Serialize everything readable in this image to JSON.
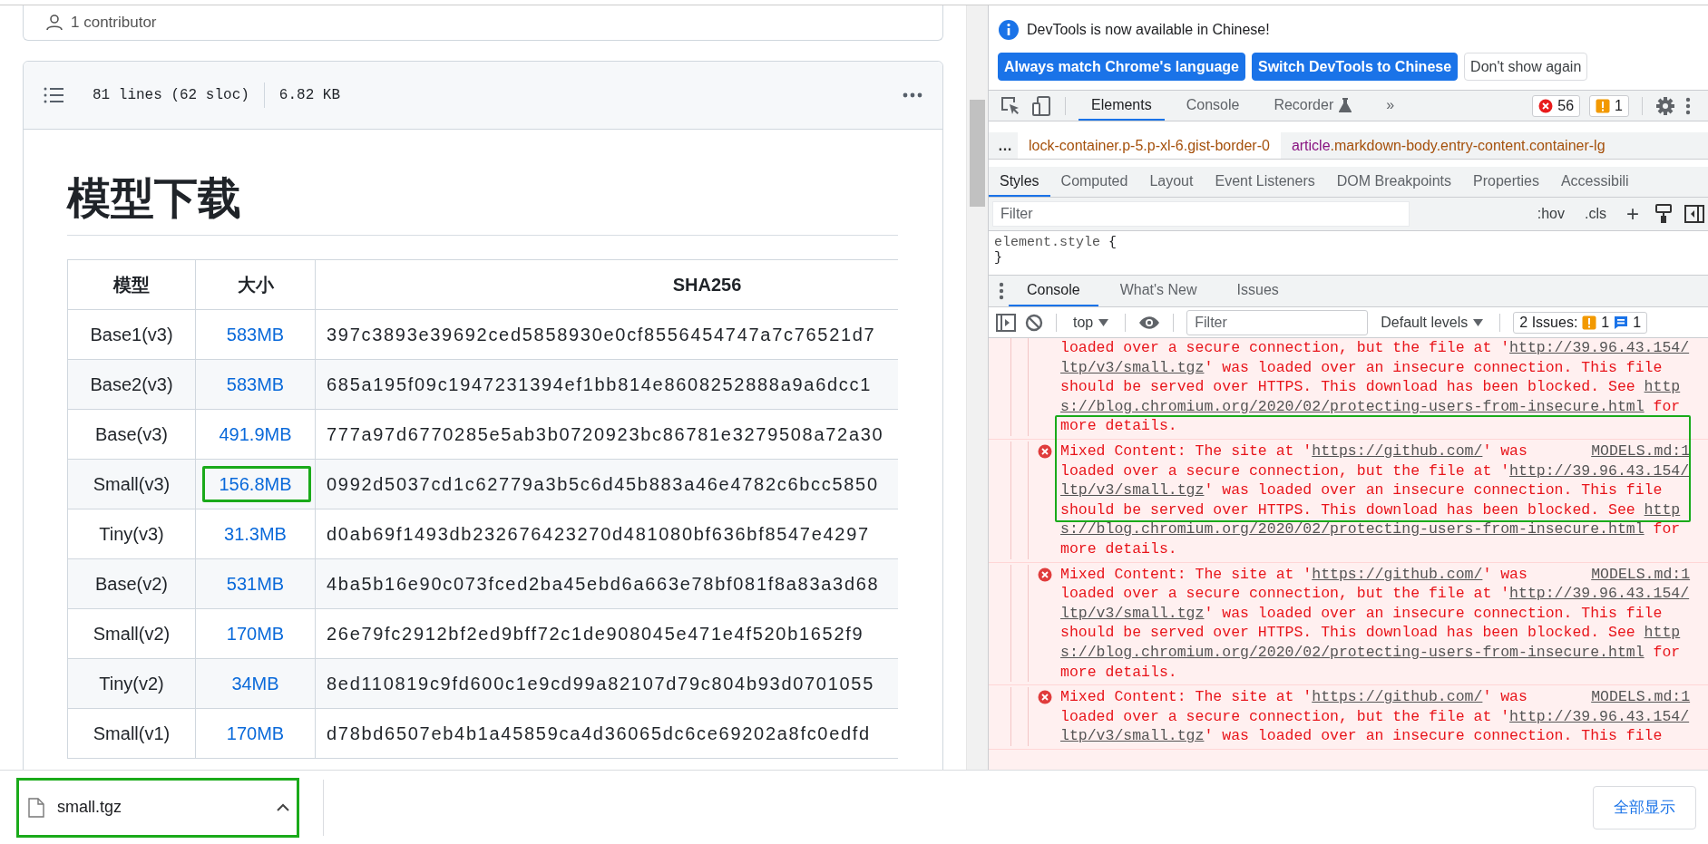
{
  "page": {
    "contributors": "1 contributor",
    "file_header": {
      "lines": "81 lines (62 sloc)",
      "size": "6.82 KB"
    },
    "heading": "模型下载",
    "table": {
      "columns": [
        "模型",
        "大小",
        "SHA256"
      ],
      "rows": [
        {
          "model": "Base1(v3)",
          "size": "583MB",
          "sha256": "397c3893e39692ced5858930e0cf8556454747a7c76521d7",
          "highlighted": false
        },
        {
          "model": "Base2(v3)",
          "size": "583MB",
          "sha256": "685a195f09c1947231394ef1bb814e8608252888a9a6dcc1",
          "highlighted": false
        },
        {
          "model": "Base(v3)",
          "size": "491.9MB",
          "sha256": "777a97d6770285e5ab3b0720923bc86781e3279508a72a30",
          "highlighted": false
        },
        {
          "model": "Small(v3)",
          "size": "156.8MB",
          "sha256": "0992d5037cd1c62779a3b5c6d45b883a46e4782c6bcc5850",
          "highlighted": true
        },
        {
          "model": "Tiny(v3)",
          "size": "31.3MB",
          "sha256": "d0ab69f1493db232676423270d481080bf636bf8547e4297",
          "highlighted": false
        },
        {
          "model": "Base(v2)",
          "size": "531MB",
          "sha256": "4ba5b16e90c073fced2ba45ebd6a663e78bf081f8a83a3d68",
          "highlighted": false
        },
        {
          "model": "Small(v2)",
          "size": "170MB",
          "sha256": "26e79fc2912bf2ed9bff72c1de908045e471e4f520b1652f9",
          "highlighted": false
        },
        {
          "model": "Tiny(v2)",
          "size": "34MB",
          "sha256": "8ed110819c9fd600c1e9cd99a82107d79c804b93d0701055",
          "highlighted": false
        },
        {
          "model": "Small(v1)",
          "size": "170MB",
          "sha256": "d78bd6507eb4b1a45859ca4d36065dc6ce69202a8fc0edfd",
          "highlighted": false
        }
      ]
    }
  },
  "devtools": {
    "notice": {
      "text": "DevTools is now available in Chinese!",
      "buttons": [
        {
          "label": "Always match Chrome's language",
          "kind": "primary"
        },
        {
          "label": "Switch DevTools to Chinese",
          "kind": "primary"
        },
        {
          "label": "Don't show again",
          "kind": "secondary"
        }
      ]
    },
    "tabs": [
      {
        "label": "Elements",
        "selected": true
      },
      {
        "label": "Console",
        "selected": false
      },
      {
        "label": "Recorder",
        "selected": false,
        "experimental": true
      }
    ],
    "more_tabs": "»",
    "error_count": "56",
    "warning_count": "1",
    "breadcrumbs": {
      "overflow": "…",
      "items": [
        {
          "classes": "lock-container.p-5.p-xl-6.gist-border-0",
          "selected": true
        },
        {
          "tag": "article",
          "classes": ".markdown-body.entry-content.container-lg",
          "selected": false
        }
      ]
    },
    "style_tabs": [
      {
        "label": "Styles",
        "selected": true
      },
      {
        "label": "Computed",
        "selected": false
      },
      {
        "label": "Layout",
        "selected": false
      },
      {
        "label": "Event Listeners",
        "selected": false
      },
      {
        "label": "DOM Breakpoints",
        "selected": false
      },
      {
        "label": "Properties",
        "selected": false
      },
      {
        "label": "Accessibili",
        "selected": false
      }
    ],
    "styles_toolbar": {
      "filter_placeholder": "Filter",
      "hov": ":hov",
      "cls": ".cls",
      "add": "+"
    },
    "rule": {
      "selector": "element.style",
      "open": "{",
      "close": "}"
    },
    "drawer_tabs": [
      {
        "label": "Console",
        "selected": true
      },
      {
        "label": "What's New",
        "selected": false
      },
      {
        "label": "Issues",
        "selected": false
      }
    ],
    "console_toolbar": {
      "context": "top",
      "filter_placeholder": "Filter",
      "levels": "Default levels",
      "issues": {
        "label": "2 Issues:",
        "warnings": "1",
        "infos": "1"
      }
    },
    "messages": [
      {
        "kind": "error",
        "highlighted": false,
        "lines": [
          [
            {
              "kind": "text",
              "text": "loaded over a secure connection, but the file at '"
            },
            {
              "kind": "link",
              "text": "http://39.96.43.154/"
            }
          ],
          [
            {
              "kind": "link",
              "text": "ltp/v3/small.tgz"
            },
            {
              "kind": "text",
              "text": "' was loaded over an insecure connection. This file"
            }
          ],
          [
            {
              "kind": "text",
              "text": "should be served over HTTPS. This download has been blocked. See "
            },
            {
              "kind": "link",
              "text": "http"
            }
          ],
          [
            {
              "kind": "link",
              "text": "s://blog.chromium.org/2020/02/protecting-users-from-insecure.html"
            },
            {
              "kind": "text",
              "text": " for"
            }
          ],
          [
            {
              "kind": "text",
              "text": "more details."
            }
          ]
        ]
      },
      {
        "kind": "error",
        "highlighted": true,
        "source": "MODELS.md:1",
        "lines": [
          [
            {
              "kind": "text",
              "text": "Mixed Content: The site at '"
            },
            {
              "kind": "link",
              "text": "https://github.com/"
            },
            {
              "kind": "text",
              "text": "' was"
            }
          ],
          [
            {
              "kind": "text",
              "text": "loaded over a secure connection, but the file at '"
            },
            {
              "kind": "link",
              "text": "http://39.96.43.154/"
            }
          ],
          [
            {
              "kind": "link",
              "text": "ltp/v3/small.tgz"
            },
            {
              "kind": "text",
              "text": "' was loaded over an insecure connection. This file"
            }
          ],
          [
            {
              "kind": "text",
              "text": "should be served over HTTPS. This download has been blocked. See "
            },
            {
              "kind": "link",
              "text": "http"
            }
          ],
          [
            {
              "kind": "link",
              "text": "s://blog.chromium.org/2020/02/protecting-users-from-insecure.html"
            },
            {
              "kind": "text",
              "text": " for"
            }
          ],
          [
            {
              "kind": "text",
              "text": "more details."
            }
          ]
        ]
      },
      {
        "kind": "error",
        "highlighted": false,
        "source": "MODELS.md:1",
        "lines": [
          [
            {
              "kind": "text",
              "text": "Mixed Content: The site at '"
            },
            {
              "kind": "link",
              "text": "https://github.com/"
            },
            {
              "kind": "text",
              "text": "' was"
            }
          ],
          [
            {
              "kind": "text",
              "text": "loaded over a secure connection, but the file at '"
            },
            {
              "kind": "link",
              "text": "http://39.96.43.154/"
            }
          ],
          [
            {
              "kind": "link",
              "text": "ltp/v3/small.tgz"
            },
            {
              "kind": "text",
              "text": "' was loaded over an insecure connection. This file"
            }
          ],
          [
            {
              "kind": "text",
              "text": "should be served over HTTPS. This download has been blocked. See "
            },
            {
              "kind": "link",
              "text": "http"
            }
          ],
          [
            {
              "kind": "link",
              "text": "s://blog.chromium.org/2020/02/protecting-users-from-insecure.html"
            },
            {
              "kind": "text",
              "text": " for"
            }
          ],
          [
            {
              "kind": "text",
              "text": "more details."
            }
          ]
        ]
      },
      {
        "kind": "error",
        "highlighted": false,
        "source": "MODELS.md:1",
        "lines": [
          [
            {
              "kind": "text",
              "text": "Mixed Content: The site at '"
            },
            {
              "kind": "link",
              "text": "https://github.com/"
            },
            {
              "kind": "text",
              "text": "' was"
            }
          ],
          [
            {
              "kind": "text",
              "text": "loaded over a secure connection, but the file at '"
            },
            {
              "kind": "link",
              "text": "http://39.96.43.154/"
            }
          ],
          [
            {
              "kind": "link",
              "text": "ltp/v3/small.tgz"
            },
            {
              "kind": "text",
              "text": "' was loaded over an insecure connection. This file"
            }
          ]
        ]
      }
    ]
  },
  "downloads": {
    "items": [
      {
        "name": "small.tgz",
        "highlighted": true
      }
    ],
    "show_all": "全部显示"
  }
}
